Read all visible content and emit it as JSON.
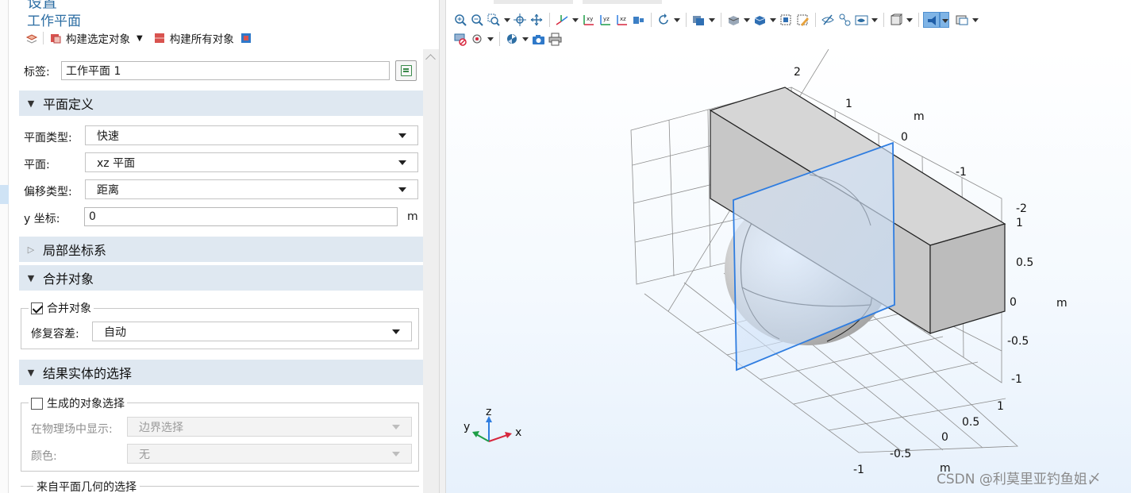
{
  "panel": {
    "heading_partial": "设置",
    "title": "工作平面",
    "build_selected_label": "构建选定对象",
    "build_all_label": "构建所有对象",
    "label_field_label": "标签:",
    "label_field_value": "工作平面 1"
  },
  "plane_definition": {
    "section_title": "平面定义",
    "plane_type_label": "平面类型:",
    "plane_type_value": "快速",
    "plane_label": "平面:",
    "plane_value": "xz 平面",
    "offset_type_label": "偏移类型:",
    "offset_type_value": "距离",
    "y_coordinate_label": "y 坐标:",
    "y_coordinate_value": "0",
    "y_coordinate_unit": "m"
  },
  "local_coordinate_system": {
    "section_title": "局部坐标系"
  },
  "unite_objects": {
    "section_title": "合并对象",
    "checkbox_label": "合并对象",
    "checked": true,
    "repair_tolerance_label": "修复容差:",
    "repair_tolerance_value": "自动"
  },
  "resulting_selection": {
    "section_title": "结果实体的选择",
    "checkbox_label": "生成的对象选择",
    "checked": false,
    "show_in_physics_label": "在物理场中显示:",
    "show_in_physics_value": "边界选择",
    "color_label": "颜色:",
    "color_value": "无",
    "plane_geometry_selection_label": "来自平面几何的选择"
  },
  "graphics": {
    "toolbar_row1_icons": [
      "zoom-in-icon",
      "zoom-out-icon",
      "zoom-box-icon",
      "zoom-extents-icon",
      "transparency-icon",
      "view-xy-icon",
      "view-yz-icon",
      "view-xz-icon",
      "camera-reset-icon",
      "rotate-icon",
      "select-objects-icon",
      "select-domains-icon",
      "select-boundaries-icon",
      "zoom-selected-icon",
      "clear-selection-icon",
      "hide-icon",
      "show-icon",
      "render-icon",
      "wireframe-icon",
      "perspective-icon",
      "scene-light-icon",
      "image-icon"
    ],
    "toolbar_row2_icons": [
      "selection-list-icon",
      "node-icon",
      "spin-icon",
      "snapshot-icon",
      "print-icon"
    ],
    "axis_labels": {
      "x_ticks": [
        "-1",
        "-0.5",
        "0",
        "0.5",
        "1"
      ],
      "y_ticks": [
        "2",
        "1",
        "0",
        "-1",
        "-2"
      ],
      "z_ticks": [
        "1",
        "0.5",
        "0",
        "-0.5",
        "-1"
      ],
      "unit": "m"
    },
    "triad": {
      "x": "x",
      "y": "y",
      "z": "z"
    },
    "watermark": "CSDN @利莫里亚钓鱼姐〆"
  },
  "colors": {
    "accent_title": "#2d6ea3",
    "section_bg": "#dfe8f1",
    "workplane_edge": "#2f7de0",
    "geometry_gray": "#c8c8c8"
  }
}
